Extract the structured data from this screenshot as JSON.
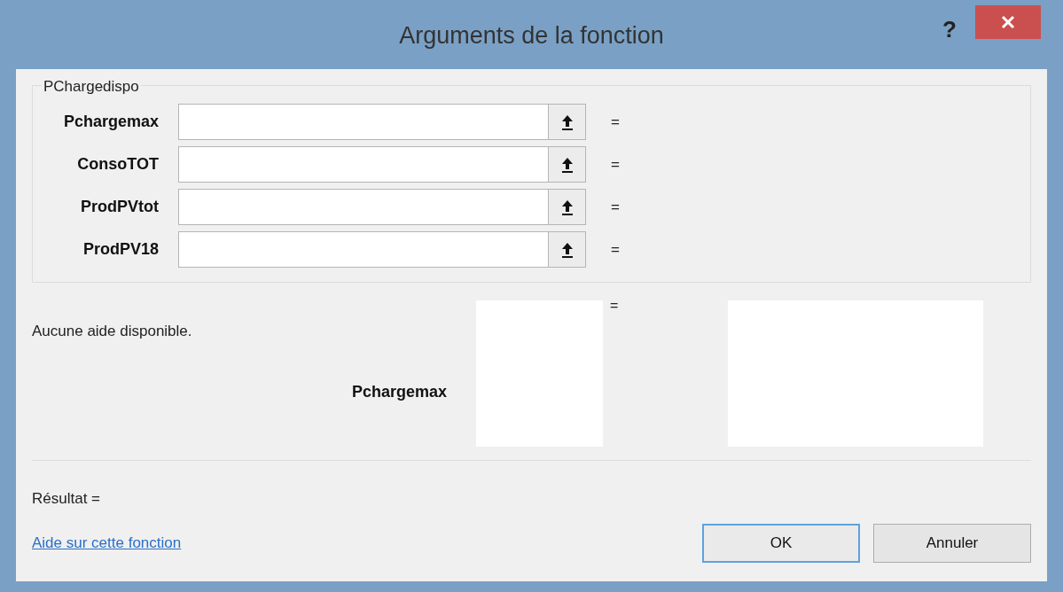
{
  "window": {
    "title": "Arguments de la fonction",
    "help_button": "?"
  },
  "group": {
    "legend": "PChargedispo",
    "arguments": [
      {
        "label": "Pchargemax",
        "equals": "="
      },
      {
        "label": "ConsoTOT",
        "equals": "="
      },
      {
        "label": "ProdPVtot",
        "equals": "="
      },
      {
        "label": "ProdPV18",
        "equals": "="
      }
    ]
  },
  "description": {
    "help_text": "Aucune aide disponible.",
    "argument_name": "Pchargemax",
    "equals": "="
  },
  "result": "Résultat =",
  "help_link": "Aide sur cette fonction",
  "buttons": [
    {
      "label": "OK",
      "focused": true
    },
    {
      "label": "Annuler",
      "focused": false
    }
  ]
}
